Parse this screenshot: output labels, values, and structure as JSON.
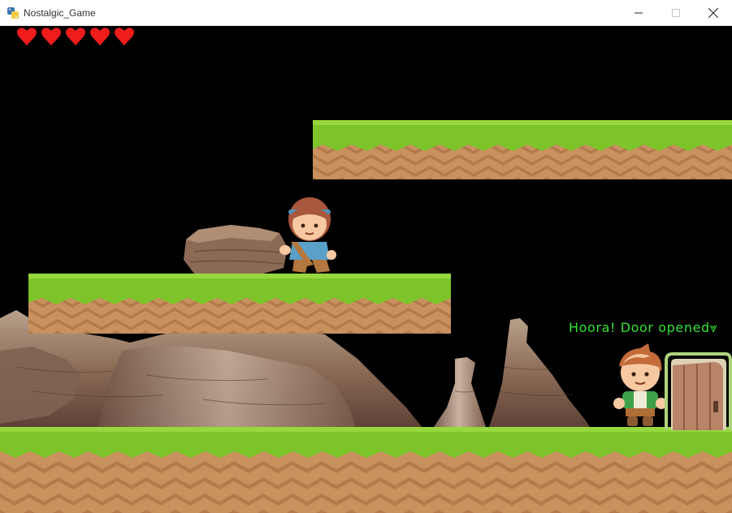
{
  "window": {
    "title": "Nostalgic_Game",
    "controls": [
      "minimize",
      "maximize",
      "close"
    ]
  },
  "hud": {
    "lives": 5,
    "life_icon": "heart-icon",
    "life_color": "#ee1c1c"
  },
  "message": {
    "text": "Hoora! Door opened⩔",
    "color": "#32e232"
  },
  "scene": {
    "platform_grass_color": "#7cc42a",
    "platform_dirt_color": "#c8915e",
    "characters": [
      "girl-character",
      "boy-character"
    ],
    "door_state": "open"
  }
}
